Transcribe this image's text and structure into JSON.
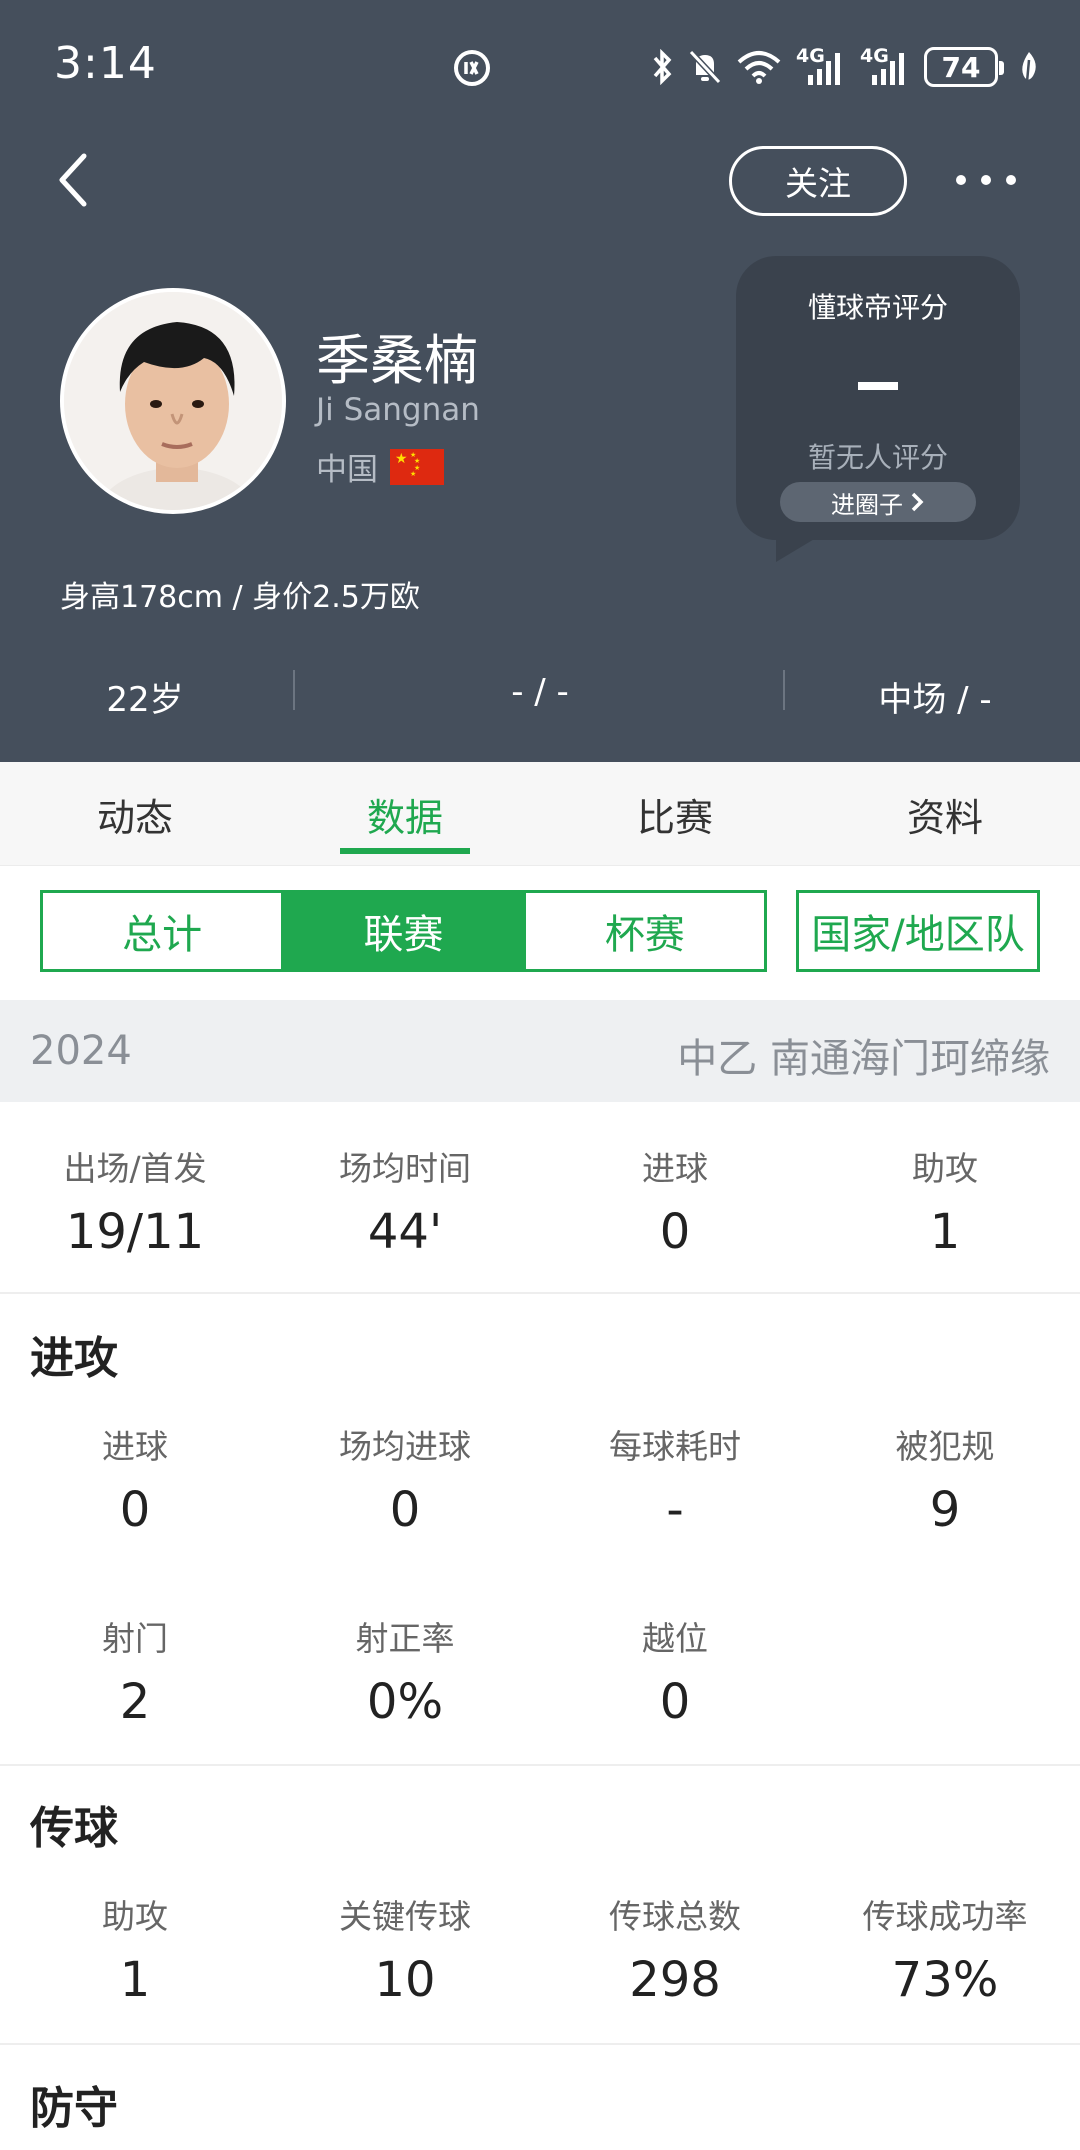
{
  "status_bar": {
    "time": "3:14",
    "network_1": "4G",
    "network_2": "4G",
    "battery": "74"
  },
  "header": {
    "follow_label": "关注",
    "player": {
      "name": "季桑楠",
      "name_en": "Ji Sangnan",
      "country": "中国"
    },
    "rating": {
      "title": "懂球帝评分",
      "value": "-",
      "subtitle": "暂无人评分",
      "link_label": "进圈子"
    },
    "height_value": "身高178cm / 身价2.5万欧",
    "info": {
      "age": "22岁",
      "number": "- / -",
      "position": "中场 / -"
    }
  },
  "tabs": [
    {
      "label": "动态"
    },
    {
      "label": "数据"
    },
    {
      "label": "比赛"
    },
    {
      "label": "资料"
    }
  ],
  "segments": {
    "items": [
      {
        "label": "总计"
      },
      {
        "label": "联赛"
      },
      {
        "label": "杯赛"
      }
    ],
    "national": "国家/地区队"
  },
  "season": {
    "year": "2024",
    "team": "中乙 南通海门珂缔缘"
  },
  "summary": [
    {
      "label": "出场/首发",
      "value": "19/11"
    },
    {
      "label": "场均时间",
      "value": "44'"
    },
    {
      "label": "进球",
      "value": "0"
    },
    {
      "label": "助攻",
      "value": "1"
    }
  ],
  "attack": {
    "title": "进攻",
    "row1": [
      {
        "label": "进球",
        "value": "0"
      },
      {
        "label": "场均进球",
        "value": "0"
      },
      {
        "label": "每球耗时",
        "value": "-"
      },
      {
        "label": "被犯规",
        "value": "9"
      }
    ],
    "row2": [
      {
        "label": "射门",
        "value": "2"
      },
      {
        "label": "射正率",
        "value": "0%"
      },
      {
        "label": "越位",
        "value": "0"
      }
    ]
  },
  "passing": {
    "title": "传球",
    "row1": [
      {
        "label": "助攻",
        "value": "1"
      },
      {
        "label": "关键传球",
        "value": "10"
      },
      {
        "label": "传球总数",
        "value": "298"
      },
      {
        "label": "传球成功率",
        "value": "73%"
      }
    ]
  },
  "defense": {
    "title": "防守"
  }
}
